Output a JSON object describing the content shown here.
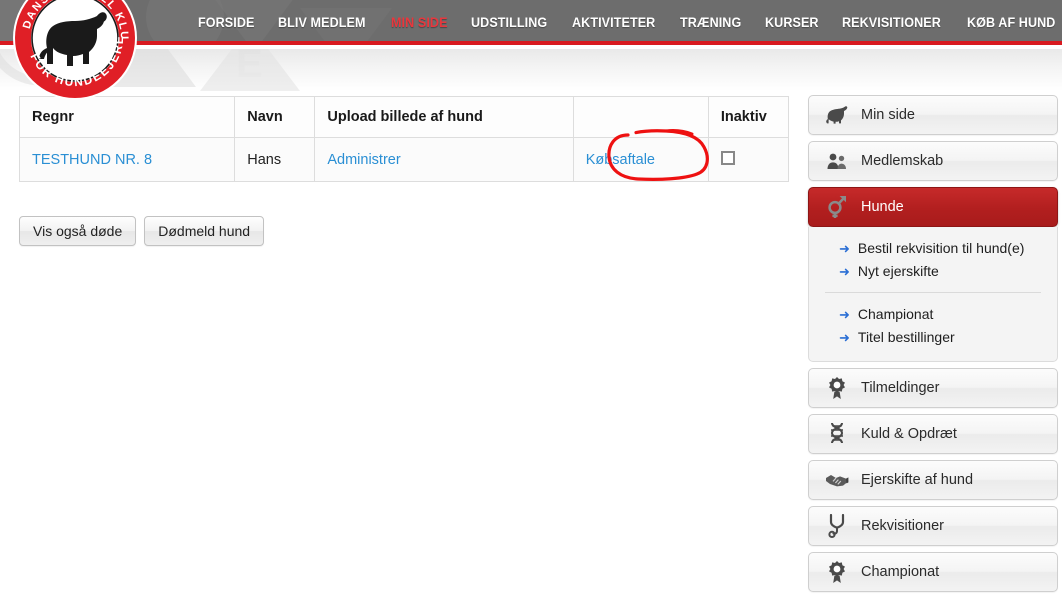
{
  "header": {
    "logo_alt": "Dansk Kennel Klub for hundeejere",
    "logo_text_top": "DANSK KENNEL KLUB",
    "logo_text_bottom": "FOR HUNDEEJERE",
    "nav": [
      {
        "label": "FORSIDE",
        "active": false
      },
      {
        "label": "BLIV MEDLEM",
        "active": false
      },
      {
        "label": "MIN SIDE",
        "active": true
      },
      {
        "label": "UDSTILLING",
        "active": false
      },
      {
        "label": "AKTIVITETER",
        "active": false
      },
      {
        "label": "TRÆNING",
        "active": false
      },
      {
        "label": "KURSER",
        "active": false
      },
      {
        "label": "REKVISITIONER",
        "active": false
      },
      {
        "label": "KØB AF HUND",
        "active": false
      }
    ],
    "accent_color": "#d81a20",
    "bar_color": "#6d6d6d",
    "active_nav_color": "#e8373d"
  },
  "table": {
    "columns": [
      "Regnr",
      "Navn",
      "Upload billede af hund",
      "",
      "Inaktiv"
    ],
    "rows": [
      {
        "regnr": "TESTHUND NR. 8",
        "navn": "Hans",
        "upload": "Administrer",
        "aftale": "Købsaftale",
        "inaktiv_checked": false
      }
    ],
    "link_color": "#2a8fd4"
  },
  "buttons": [
    {
      "label": "Vis også døde"
    },
    {
      "label": "Dødmeld hund"
    }
  ],
  "sidebar": {
    "items": [
      {
        "label": "Min side",
        "icon": "dog-icon",
        "active": false
      },
      {
        "label": "Medlemskab",
        "icon": "people-icon",
        "active": false
      },
      {
        "label": "Hunde",
        "icon": "gender-icon",
        "active": true
      },
      {
        "label": "Tilmeldinger",
        "icon": "rosette-icon",
        "active": false
      },
      {
        "label": "Kuld & Opdræt",
        "icon": "dna-icon",
        "active": false
      },
      {
        "label": "Ejerskifte af hund",
        "icon": "handshake-icon",
        "active": false
      },
      {
        "label": "Rekvisitioner",
        "icon": "stethoscope-icon",
        "active": false
      },
      {
        "label": "Championat",
        "icon": "rosette-icon",
        "active": false
      }
    ],
    "submenu": {
      "group1": [
        {
          "label": "Bestil rekvisition til hund(e)"
        },
        {
          "label": "Nyt ejerskifte"
        }
      ],
      "group2": [
        {
          "label": "Championat"
        },
        {
          "label": "Titel bestillinger"
        }
      ],
      "arrow_color": "#2a6ed4"
    },
    "active_color": "#b21f1f"
  },
  "annotation": {
    "type": "hand-drawn-ellipse",
    "target": "Købsaftale",
    "color": "#ee1111"
  }
}
